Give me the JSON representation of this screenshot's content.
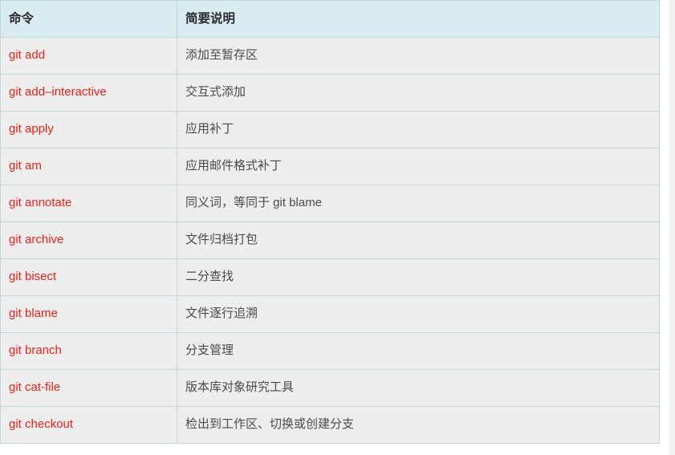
{
  "table": {
    "headers": {
      "command": "命令",
      "description": "简要说明"
    },
    "rows": [
      {
        "command": "git add",
        "description": "添加至暂存区"
      },
      {
        "command": "git add–interactive",
        "description": "交互式添加"
      },
      {
        "command": "git apply",
        "description": "应用补丁"
      },
      {
        "command": "git am",
        "description": "应用邮件格式补丁"
      },
      {
        "command": "git annotate",
        "description": "同义词，等同于 git blame"
      },
      {
        "command": "git archive",
        "description": "文件归档打包"
      },
      {
        "command": "git bisect",
        "description": "二分查找"
      },
      {
        "command": "git blame",
        "description": "文件逐行追溯"
      },
      {
        "command": "git branch",
        "description": "分支管理"
      },
      {
        "command": "git cat-file",
        "description": "版本库对象研究工具"
      },
      {
        "command": "git checkout",
        "description": "检出到工作区、切换或创建分支"
      }
    ]
  },
  "colors": {
    "header_background": "#d9ecf2",
    "row_background": "#ededed",
    "border": "#bdd8d8",
    "link": "#ef1f19",
    "description_text": "#4a4a4a",
    "scrollbar_track": "#f1f1f1"
  }
}
